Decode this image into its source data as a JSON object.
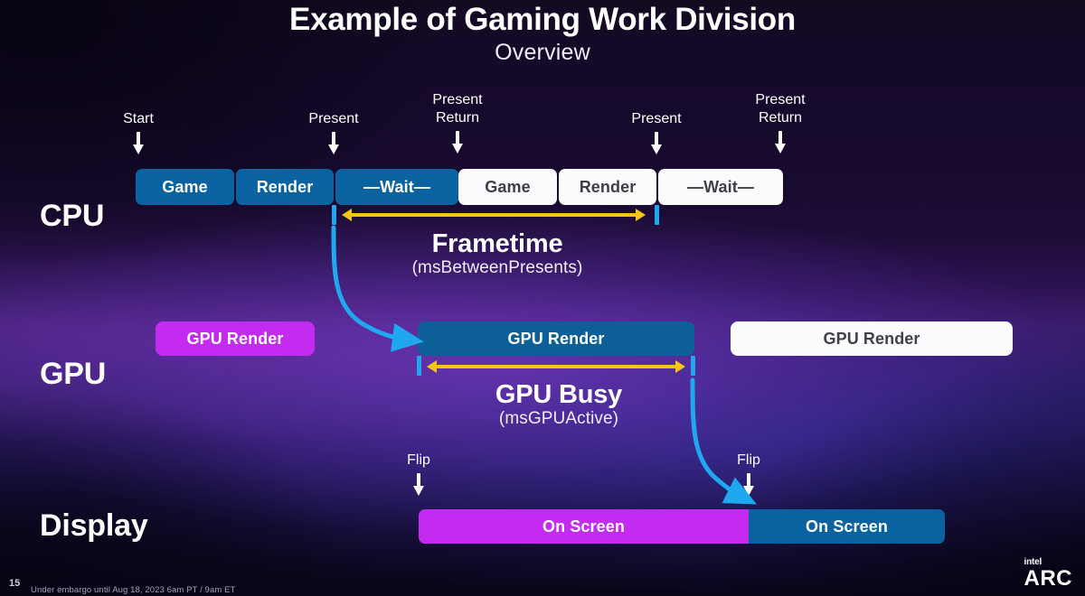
{
  "slide": {
    "title": "Example of Gaming Work Division",
    "subtitle": "Overview"
  },
  "rows": {
    "cpu_label": "CPU",
    "gpu_label": "GPU",
    "display_label": "Display"
  },
  "markers": [
    {
      "name": "start",
      "text": "Start"
    },
    {
      "name": "present-1",
      "text": "Present"
    },
    {
      "name": "present-return-1",
      "text": "Present\nReturn"
    },
    {
      "name": "present-2",
      "text": "Present"
    },
    {
      "name": "present-return-2",
      "text": "Present\nReturn"
    },
    {
      "name": "flip-1",
      "text": "Flip"
    },
    {
      "name": "flip-2",
      "text": "Flip"
    }
  ],
  "cpu_bars": [
    {
      "label": "Game",
      "style": "blue"
    },
    {
      "label": "Render",
      "style": "blue"
    },
    {
      "label": "—Wait—",
      "style": "blue"
    },
    {
      "label": "Game",
      "style": "white"
    },
    {
      "label": "Render",
      "style": "white"
    },
    {
      "label": "—Wait—",
      "style": "white"
    }
  ],
  "gpu_bars": [
    {
      "label": "GPU Render",
      "style": "magenta"
    },
    {
      "label": "GPU Render",
      "style": "blue"
    },
    {
      "label": "GPU Render",
      "style": "white"
    }
  ],
  "display_bars": [
    {
      "label": "On Screen",
      "style": "magenta"
    },
    {
      "label": "On Screen",
      "style": "blue"
    }
  ],
  "measures": {
    "frametime": {
      "title": "Frametime",
      "metric": "(msBetweenPresents)"
    },
    "gpu_busy": {
      "title": "GPU Busy",
      "metric": "(msGPUActive)"
    }
  },
  "footer": {
    "page_number": "15",
    "embargo": "Under embargo until Aug 18, 2023 6am PT / 9am ET"
  },
  "logo": {
    "brand": "intel",
    "product": "ARC"
  },
  "colors": {
    "blue_bar": "#0a63a0",
    "white_bar": "#fbfbfd",
    "magenta_bar": "#c32cf0",
    "cyan_marker": "#1fa8ef",
    "yellow_measure": "#f5c518",
    "text_on_white": "#3f3f46"
  }
}
